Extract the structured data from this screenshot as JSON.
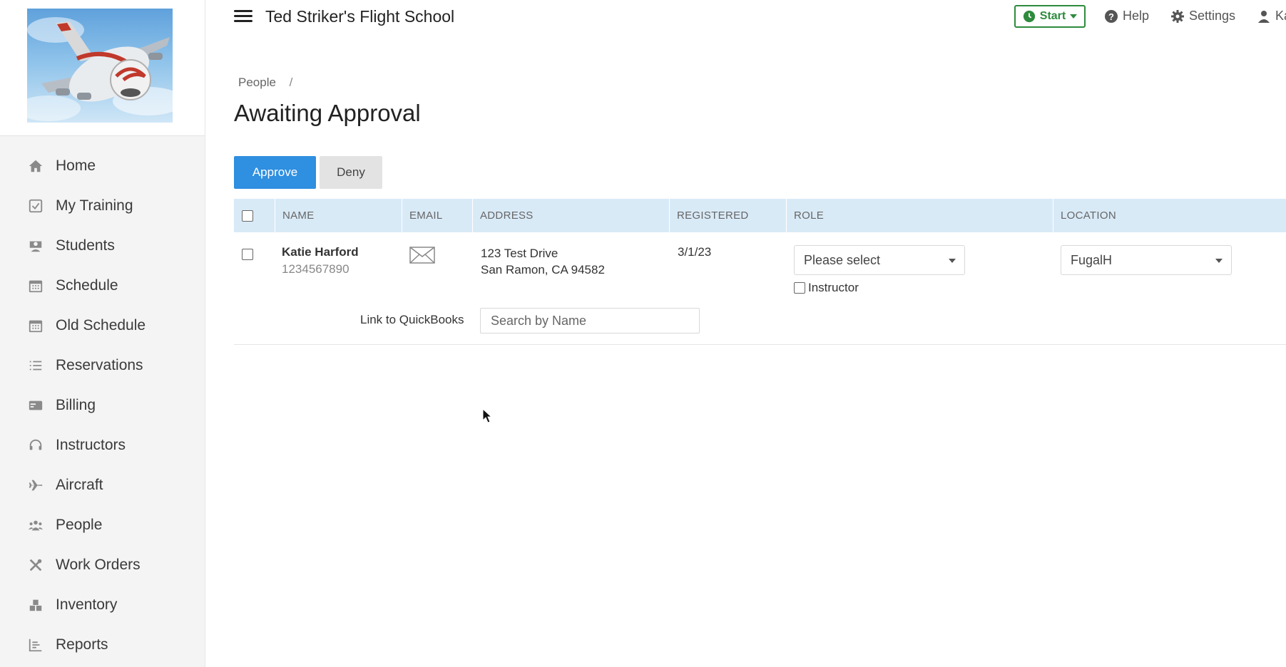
{
  "app": {
    "title": "Ted Striker's Flight School"
  },
  "header": {
    "start_label": "Start",
    "help_label": "Help",
    "settings_label": "Settings",
    "user_label": "Ka"
  },
  "sidebar": {
    "items": [
      {
        "label": "Home",
        "icon": "home-icon"
      },
      {
        "label": "My Training",
        "icon": "checkbox-icon"
      },
      {
        "label": "Students",
        "icon": "student-icon"
      },
      {
        "label": "Schedule",
        "icon": "calendar-icon"
      },
      {
        "label": "Old Schedule",
        "icon": "calendar-icon"
      },
      {
        "label": "Reservations",
        "icon": "list-icon"
      },
      {
        "label": "Billing",
        "icon": "card-icon"
      },
      {
        "label": "Instructors",
        "icon": "headset-icon"
      },
      {
        "label": "Aircraft",
        "icon": "plane-icon"
      },
      {
        "label": "People",
        "icon": "people-icon"
      },
      {
        "label": "Work Orders",
        "icon": "tools-icon"
      },
      {
        "label": "Inventory",
        "icon": "boxes-icon"
      },
      {
        "label": "Reports",
        "icon": "chart-icon"
      }
    ]
  },
  "breadcrumb": {
    "parent": "People",
    "separator": "/"
  },
  "page": {
    "title": "Awaiting Approval"
  },
  "actions": {
    "approve_label": "Approve",
    "deny_label": "Deny"
  },
  "table": {
    "columns": [
      "NAME",
      "EMAIL",
      "ADDRESS",
      "REGISTERED",
      "ROLE",
      "LOCATION"
    ],
    "rows": [
      {
        "name": "Katie Harford",
        "phone": "1234567890",
        "address_line1": "123 Test Drive",
        "address_line2": "San Ramon, CA 94582",
        "registered": "3/1/23",
        "role_value": "Please select",
        "instructor_label": "Instructor",
        "location_value": "FugalH",
        "quickbooks_label": "Link to QuickBooks",
        "quickbooks_placeholder": "Search by Name"
      }
    ]
  },
  "colors": {
    "primary": "#2f8fe0",
    "start_green": "#2e8b3d",
    "table_header": "#d9eaf7"
  }
}
